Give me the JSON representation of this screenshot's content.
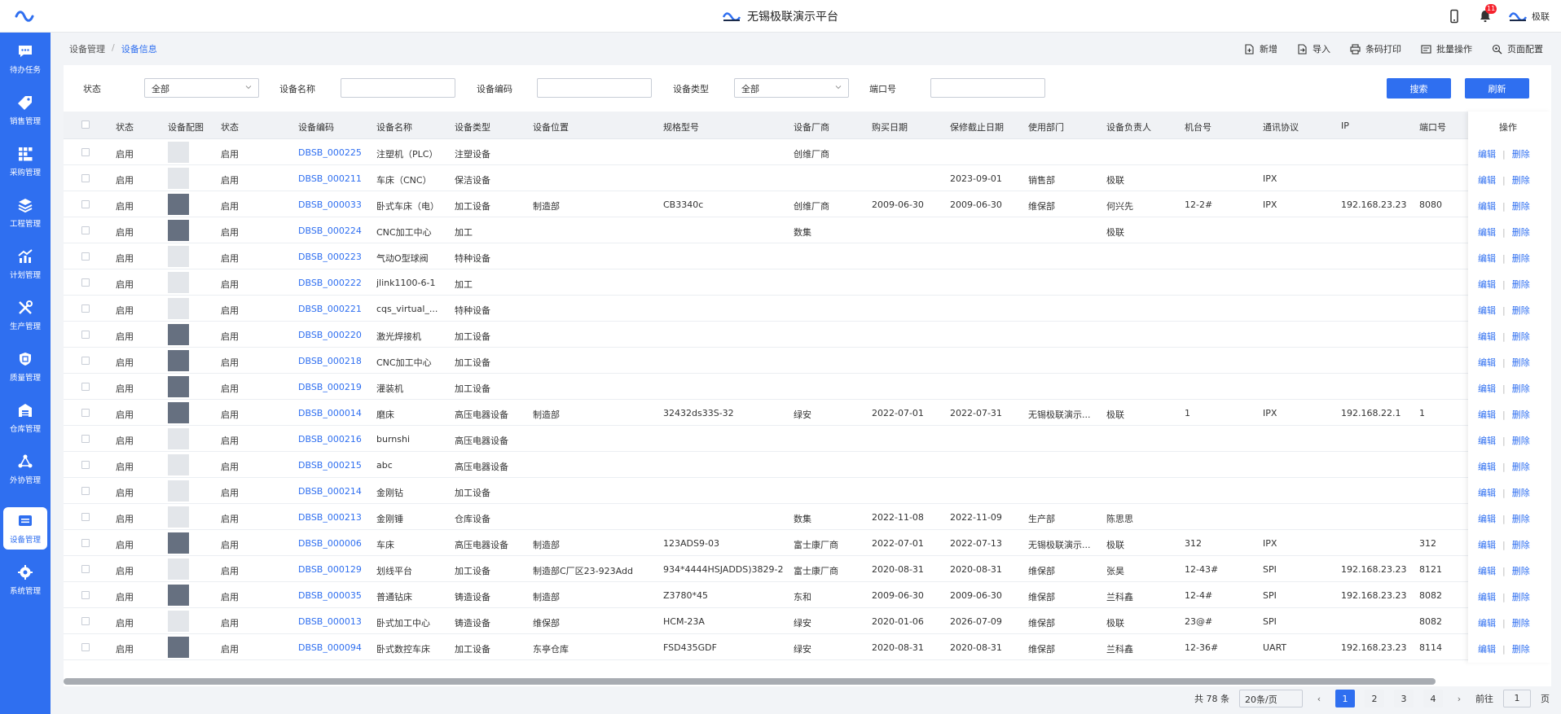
{
  "app": {
    "title": "无锡极联演示平台",
    "user": "极联",
    "notification_count": "11"
  },
  "sidebar": {
    "items": [
      {
        "label": "待办任务",
        "icon": "chat-icon"
      },
      {
        "label": "销售管理",
        "icon": "tag-icon"
      },
      {
        "label": "采购管理",
        "icon": "grid-icon"
      },
      {
        "label": "工程管理",
        "icon": "layers-icon"
      },
      {
        "label": "计划管理",
        "icon": "chart-icon"
      },
      {
        "label": "生产管理",
        "icon": "tools-icon"
      },
      {
        "label": "质量管理",
        "icon": "shield-icon"
      },
      {
        "label": "仓库管理",
        "icon": "warehouse-icon"
      },
      {
        "label": "外协管理",
        "icon": "network-icon"
      },
      {
        "label": "设备管理",
        "icon": "device-icon",
        "active": true
      },
      {
        "label": "系统管理",
        "icon": "gear-icon"
      }
    ]
  },
  "breadcrumb": {
    "parent": "设备管理",
    "separator": "/",
    "current": "设备信息"
  },
  "actions": {
    "add": "新增",
    "import": "导入",
    "barcode_print": "条码打印",
    "batch": "批量操作",
    "page_config": "页面配置"
  },
  "filters": {
    "status_label": "状态",
    "status_value": "全部",
    "name_label": "设备名称",
    "name_value": "",
    "code_label": "设备编码",
    "code_value": "",
    "type_label": "设备类型",
    "type_value": "全部",
    "port_label": "端口号",
    "port_value": "",
    "search_button": "搜索",
    "refresh_button": "刷新"
  },
  "table": {
    "headers": {
      "status": "状态",
      "image": "设备配图",
      "status2": "状态",
      "code": "设备编码",
      "name": "设备名称",
      "type": "设备类型",
      "location": "设备位置",
      "model": "规格型号",
      "maker": "设备厂商",
      "purchase": "购买日期",
      "warranty": "保修截止日期",
      "dept": "使用部门",
      "owner": "设备负责人",
      "machine": "机台号",
      "protocol": "通讯协议",
      "ip": "IP",
      "port": "端口号",
      "ops": "操作"
    },
    "op_edit": "编辑",
    "op_sep": "|",
    "op_delete": "删除",
    "rows": [
      {
        "status": "启用",
        "photo": false,
        "status2": "启用",
        "code": "DBSB_000225",
        "name": "注塑机（PLC）",
        "type": "注塑设备",
        "location": "",
        "model": "",
        "maker": "创维厂商",
        "purchase": "",
        "warranty": "",
        "dept": "",
        "owner": "",
        "machine": "",
        "protocol": "",
        "ip": "",
        "port": ""
      },
      {
        "status": "启用",
        "photo": false,
        "status2": "启用",
        "code": "DBSB_000211",
        "name": "车床（CNC）",
        "type": "保洁设备",
        "location": "",
        "model": "",
        "maker": "",
        "purchase": "",
        "warranty": "2023-09-01",
        "dept": "销售部",
        "owner": "极联",
        "machine": "",
        "protocol": "IPX",
        "ip": "",
        "port": ""
      },
      {
        "status": "启用",
        "photo": true,
        "status2": "启用",
        "code": "DBSB_000033",
        "name": "卧式车床（电）",
        "type": "加工设备",
        "location": "制造部",
        "model": "CB3340c",
        "maker": "创维厂商",
        "purchase": "2009-06-30",
        "warranty": "2009-06-30",
        "dept": "维保部",
        "owner": "何兴先",
        "machine": "12-2#",
        "protocol": "IPX",
        "ip": "192.168.23.23",
        "port": "8080"
      },
      {
        "status": "启用",
        "photo": true,
        "status2": "启用",
        "code": "DBSB_000224",
        "name": "CNC加工中心",
        "type": "加工",
        "location": "",
        "model": "",
        "maker": "数集",
        "purchase": "",
        "warranty": "",
        "dept": "",
        "owner": "极联",
        "machine": "",
        "protocol": "",
        "ip": "",
        "port": ""
      },
      {
        "status": "启用",
        "photo": false,
        "status2": "启用",
        "code": "DBSB_000223",
        "name": "气动O型球阀",
        "type": "特种设备",
        "location": "",
        "model": "",
        "maker": "",
        "purchase": "",
        "warranty": "",
        "dept": "",
        "owner": "",
        "machine": "",
        "protocol": "",
        "ip": "",
        "port": ""
      },
      {
        "status": "启用",
        "photo": false,
        "status2": "启用",
        "code": "DBSB_000222",
        "name": "jlink1100-6-1",
        "type": "加工",
        "location": "",
        "model": "",
        "maker": "",
        "purchase": "",
        "warranty": "",
        "dept": "",
        "owner": "",
        "machine": "",
        "protocol": "",
        "ip": "",
        "port": ""
      },
      {
        "status": "启用",
        "photo": false,
        "status2": "启用",
        "code": "DBSB_000221",
        "name": "cqs_virtual_...",
        "type": "特种设备",
        "location": "",
        "model": "",
        "maker": "",
        "purchase": "",
        "warranty": "",
        "dept": "",
        "owner": "",
        "machine": "",
        "protocol": "",
        "ip": "",
        "port": ""
      },
      {
        "status": "启用",
        "photo": true,
        "status2": "启用",
        "code": "DBSB_000220",
        "name": "激光焊接机",
        "type": "加工设备",
        "location": "",
        "model": "",
        "maker": "",
        "purchase": "",
        "warranty": "",
        "dept": "",
        "owner": "",
        "machine": "",
        "protocol": "",
        "ip": "",
        "port": ""
      },
      {
        "status": "启用",
        "photo": true,
        "status2": "启用",
        "code": "DBSB_000218",
        "name": "CNC加工中心",
        "type": "加工设备",
        "location": "",
        "model": "",
        "maker": "",
        "purchase": "",
        "warranty": "",
        "dept": "",
        "owner": "",
        "machine": "",
        "protocol": "",
        "ip": "",
        "port": ""
      },
      {
        "status": "启用",
        "photo": true,
        "status2": "启用",
        "code": "DBSB_000219",
        "name": "灌装机",
        "type": "加工设备",
        "location": "",
        "model": "",
        "maker": "",
        "purchase": "",
        "warranty": "",
        "dept": "",
        "owner": "",
        "machine": "",
        "protocol": "",
        "ip": "",
        "port": ""
      },
      {
        "status": "启用",
        "photo": true,
        "status2": "启用",
        "code": "DBSB_000014",
        "name": "磨床",
        "type": "高压电器设备",
        "location": "制造部",
        "model": "32432ds33S-32",
        "maker": "绿安",
        "purchase": "2022-07-01",
        "warranty": "2022-07-31",
        "dept": "无锡极联演示...",
        "owner": "极联",
        "machine": "1",
        "protocol": "IPX",
        "ip": "192.168.22.1",
        "port": "1"
      },
      {
        "status": "启用",
        "photo": false,
        "status2": "启用",
        "code": "DBSB_000216",
        "name": "burnshi",
        "type": "高压电器设备",
        "location": "",
        "model": "",
        "maker": "",
        "purchase": "",
        "warranty": "",
        "dept": "",
        "owner": "",
        "machine": "",
        "protocol": "",
        "ip": "",
        "port": ""
      },
      {
        "status": "启用",
        "photo": false,
        "status2": "启用",
        "code": "DBSB_000215",
        "name": "abc",
        "type": "高压电器设备",
        "location": "",
        "model": "",
        "maker": "",
        "purchase": "",
        "warranty": "",
        "dept": "",
        "owner": "",
        "machine": "",
        "protocol": "",
        "ip": "",
        "port": ""
      },
      {
        "status": "启用",
        "photo": false,
        "status2": "启用",
        "code": "DBSB_000214",
        "name": "金刚钻",
        "type": "加工设备",
        "location": "",
        "model": "",
        "maker": "",
        "purchase": "",
        "warranty": "",
        "dept": "",
        "owner": "",
        "machine": "",
        "protocol": "",
        "ip": "",
        "port": ""
      },
      {
        "status": "启用",
        "photo": false,
        "status2": "启用",
        "code": "DBSB_000213",
        "name": "金刚锤",
        "type": "仓库设备",
        "location": "",
        "model": "",
        "maker": "数集",
        "purchase": "2022-11-08",
        "warranty": "2022-11-09",
        "dept": "生产部",
        "owner": "陈思思",
        "machine": "",
        "protocol": "",
        "ip": "",
        "port": ""
      },
      {
        "status": "启用",
        "photo": true,
        "status2": "启用",
        "code": "DBSB_000006",
        "name": "车床",
        "type": "高压电器设备",
        "location": "制造部",
        "model": "123ADS9-03",
        "maker": "富士康厂商",
        "purchase": "2022-07-01",
        "warranty": "2022-07-13",
        "dept": "无锡极联演示...",
        "owner": "极联",
        "machine": "312",
        "protocol": "IPX",
        "ip": "",
        "port": "312"
      },
      {
        "status": "启用",
        "photo": false,
        "status2": "启用",
        "code": "DBSB_000129",
        "name": "划线平台",
        "type": "加工设备",
        "location": "制造部C厂区23-923Add",
        "model": "934*4444HSJADDS)3829-2",
        "maker": "富士康厂商",
        "purchase": "2020-08-31",
        "warranty": "2020-08-31",
        "dept": "维保部",
        "owner": "张昊",
        "machine": "12-43#",
        "protocol": "SPI",
        "ip": "192.168.23.23",
        "port": "8121"
      },
      {
        "status": "启用",
        "photo": true,
        "status2": "启用",
        "code": "DBSB_000035",
        "name": "普通钻床",
        "type": "铸造设备",
        "location": "制造部",
        "model": "Z3780*45",
        "maker": "东和",
        "purchase": "2009-06-30",
        "warranty": "2009-06-30",
        "dept": "维保部",
        "owner": "兰科鑫",
        "machine": "12-4#",
        "protocol": "SPI",
        "ip": "192.168.23.23",
        "port": "8082"
      },
      {
        "status": "启用",
        "photo": false,
        "status2": "启用",
        "code": "DBSB_000013",
        "name": "卧式加工中心",
        "type": "铸造设备",
        "location": "维保部",
        "model": "HCM-23A",
        "maker": "绿安",
        "purchase": "2020-01-06",
        "warranty": "2026-07-09",
        "dept": "维保部",
        "owner": "极联",
        "machine": "23@#",
        "protocol": "SPI",
        "ip": "",
        "port": "8082"
      },
      {
        "status": "启用",
        "photo": true,
        "status2": "启用",
        "code": "DBSB_000094",
        "name": "卧式数控车床",
        "type": "加工设备",
        "location": "东亭仓库",
        "model": "FSD435GDF",
        "maker": "绿安",
        "purchase": "2020-08-31",
        "warranty": "2020-08-31",
        "dept": "维保部",
        "owner": "兰科鑫",
        "machine": "12-36#",
        "protocol": "UART",
        "ip": "192.168.23.23",
        "port": "8114"
      }
    ]
  },
  "pagination": {
    "total": "共 78 条",
    "page_size": "20条/页",
    "pages": [
      "1",
      "2",
      "3",
      "4"
    ],
    "current": "1",
    "goto_label": "前往",
    "goto_value": "1",
    "page_unit": "页"
  },
  "colors": {
    "primary": "#2f6ff0",
    "sidebar": "#2f6ff0",
    "badge": "#f5222d"
  }
}
